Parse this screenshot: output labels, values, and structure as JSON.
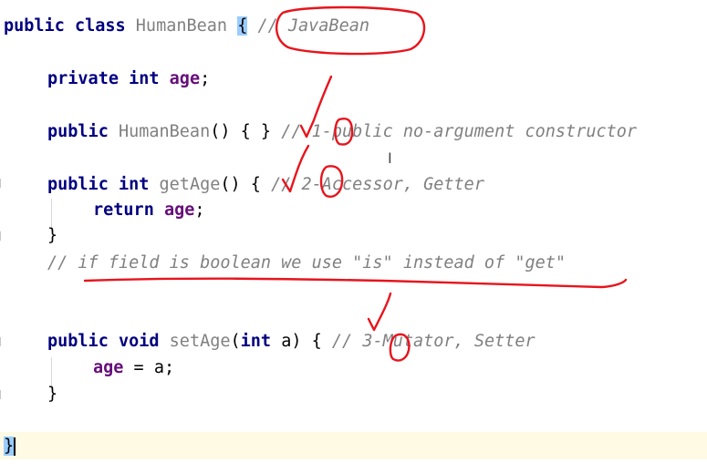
{
  "code": {
    "class_kw": "public class",
    "class_name": "HumanBean",
    "class_open": "{",
    "class_comment": "// JavaBean",
    "field_kw": "private int",
    "field_name": "age",
    "field_end": ";",
    "ctor_kw": "public",
    "ctor_name": "HumanBean",
    "ctor_body": "() { }",
    "ctor_comment": "// 1-public no-argument constructor",
    "getter_kw": "public int",
    "getter_name": "getAge",
    "getter_open": "() {",
    "getter_comment": "// 2-Accessor, Getter",
    "return_kw": "return",
    "return_field": "age",
    "return_end": ";",
    "getter_close": "}",
    "note_comment": "// if field is boolean we use \"is\" instead of \"get\"",
    "setter_kw": "public void",
    "setter_name": "setAge",
    "setter_paren_open": "(",
    "setter_param_kw": "int",
    "setter_param_rest": " a) {",
    "setter_comment": "// 3-Mutator, Setter",
    "assign_field": "age",
    "assign_rest": " = a;",
    "setter_close": "}",
    "class_close": "}"
  },
  "colors": {
    "keyword": "#000080",
    "field": "#660e7a",
    "comment": "#808080",
    "annotation": "#e8141c",
    "caret_line": "#fffae3",
    "brace_highlight": "#99ccff"
  }
}
